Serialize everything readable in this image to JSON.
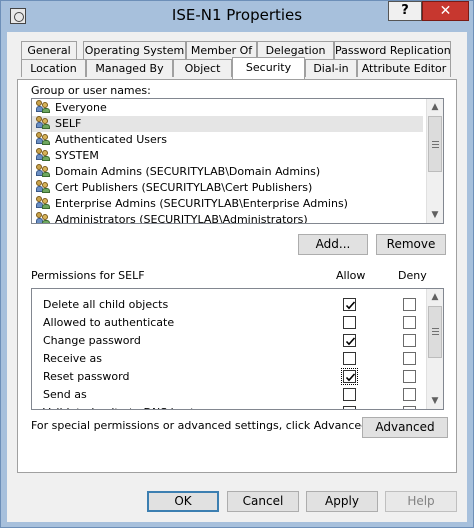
{
  "window": {
    "title": "ISE-N1 Properties",
    "help_glyph": "?",
    "close_glyph": "✕"
  },
  "tabs_row1": [
    "General",
    "Operating System",
    "Member Of",
    "Delegation",
    "Password Replication"
  ],
  "tabs_row2": [
    "Location",
    "Managed By",
    "Object",
    "Security",
    "Dial-in",
    "Attribute Editor"
  ],
  "active_tab": "Security",
  "security": {
    "group_label": "Group or user names:",
    "users": [
      {
        "name": "Everyone",
        "selected": false
      },
      {
        "name": "SELF",
        "selected": true
      },
      {
        "name": "Authenticated Users",
        "selected": false
      },
      {
        "name": "SYSTEM",
        "selected": false
      },
      {
        "name": "Domain Admins (SECURITYLAB\\Domain Admins)",
        "selected": false
      },
      {
        "name": "Cert Publishers (SECURITYLAB\\Cert Publishers)",
        "selected": false
      },
      {
        "name": "Enterprise Admins (SECURITYLAB\\Enterprise Admins)",
        "selected": false
      },
      {
        "name": "Administrators (SECURITYLAB\\Administrators)",
        "selected": false
      }
    ],
    "add_label": "Add...",
    "remove_label": "Remove",
    "permissions_label": "Permissions for SELF",
    "allow_header": "Allow",
    "deny_header": "Deny",
    "permissions": [
      {
        "name": "Delete all child objects",
        "allow": true,
        "deny": false
      },
      {
        "name": "Allowed to authenticate",
        "allow": false,
        "deny": false
      },
      {
        "name": "Change password",
        "allow": true,
        "deny": false
      },
      {
        "name": "Receive as",
        "allow": false,
        "deny": false
      },
      {
        "name": "Reset password",
        "allow": true,
        "deny": false
      },
      {
        "name": "Send as",
        "allow": false,
        "deny": false
      },
      {
        "name": "Validated write to DNS host name",
        "allow": true,
        "deny": false
      }
    ],
    "advanced_hint": "For special permissions or advanced settings, click Advanced.",
    "advanced_label": "Advanced"
  },
  "footer": {
    "ok_label": "OK",
    "cancel_label": "Cancel",
    "apply_label": "Apply",
    "help_label": "Help"
  },
  "colors": {
    "title_bar": "#a7c0dc",
    "close_red": "#c7372f",
    "selection_gray": "#e5e5e5",
    "default_button_border": "#3c7fb1"
  }
}
